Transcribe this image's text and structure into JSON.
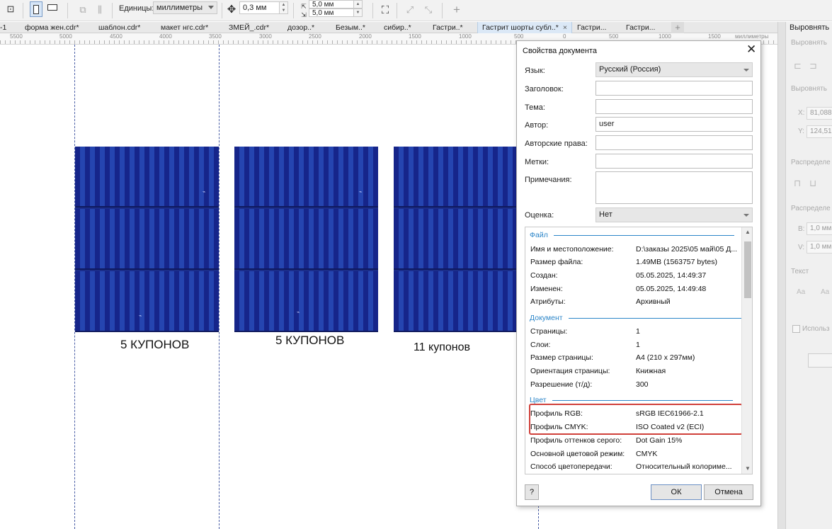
{
  "toolbar": {
    "units_label": "Единицы:",
    "units_value": "миллиметры",
    "nudge_value": "0,3 мм",
    "dup_x": "5,0 мм",
    "dup_y": "5,0 мм"
  },
  "tabs": [
    {
      "label": "-1"
    },
    {
      "label": "форма жен.cdr*"
    },
    {
      "label": "шаблон.cdr*"
    },
    {
      "label": "макет нгс.cdr*"
    },
    {
      "label": "ЗМЕЙ_.cdr*"
    },
    {
      "label": "дозор..*"
    },
    {
      "label": "Безым..*"
    },
    {
      "label": "сибир..*"
    },
    {
      "label": "Гастри..*"
    },
    {
      "label": "Гастрит шорты субл..*"
    },
    {
      "label": "Гастри..."
    },
    {
      "label": "Гастри..."
    }
  ],
  "ruler": {
    "ticks": [
      "5500",
      "5000",
      "4500",
      "4000",
      "3500",
      "3000",
      "2500",
      "2000",
      "1500",
      "1000",
      "500",
      "0",
      "500",
      "1000",
      "1500"
    ],
    "unit": "миллиметры"
  },
  "canvas": {
    "captions": [
      "5 КУПОНОВ",
      "5 КУПОНОВ",
      "11 купонов"
    ]
  },
  "panel": {
    "title": "Выровнять",
    "sub1": "Выровнять",
    "sub2": "Выровнять",
    "x_label": "X:",
    "x_value": "81,088",
    "y_label": "Y:",
    "y_value": "124,51",
    "distribute1": "Распределе",
    "distribute2": "Распределе",
    "b_label": "В:",
    "b_value": "1,0 мм",
    "v_label": "V:",
    "v_value": "1,0 мм",
    "text_label": "Текст",
    "use_label": "Использ"
  },
  "dialog": {
    "title": "Свойства документа",
    "fields": {
      "language_label": "Язык:",
      "language_value": "Русский (Россия)",
      "title_label": "Заголовок:",
      "subject_label": "Тема:",
      "author_label": "Автор:",
      "author_value": "user",
      "copyright_label": "Авторские права:",
      "keywords_label": "Метки:",
      "notes_label": "Примечания:",
      "rating_label": "Оценка:",
      "rating_value": "Нет"
    },
    "sections": {
      "file": "Файл",
      "document": "Документ",
      "color": "Цвет"
    },
    "file_info": [
      {
        "k": "Имя и местоположение:",
        "v": "D:\\заказы 2025\\05 май\\05 Д..."
      },
      {
        "k": "Размер файла:",
        "v": "1.49MB (1563757 bytes)"
      },
      {
        "k": "Создан:",
        "v": "05.05.2025, 14:49:37"
      },
      {
        "k": "Изменен:",
        "v": "05.05.2025, 14:49:48"
      },
      {
        "k": "Атрибуты:",
        "v": "Архивный"
      }
    ],
    "doc_info": [
      {
        "k": "Страницы:",
        "v": "1"
      },
      {
        "k": "Слои:",
        "v": "1"
      },
      {
        "k": "Размер страницы:",
        "v": "A4 (210 x 297мм)"
      },
      {
        "k": "Ориентация страницы:",
        "v": "Книжная"
      },
      {
        "k": "Разрешение (т/д):",
        "v": "300"
      }
    ],
    "color_info": [
      {
        "k": "Профиль RGB:",
        "v": "sRGB IEC61966-2.1"
      },
      {
        "k": "Профиль CMYK:",
        "v": "ISO Coated v2 (ECI)"
      },
      {
        "k": "Профиль оттенков серого:",
        "v": "Dot Gain 15%"
      },
      {
        "k": "Основной цветовой режим:",
        "v": "CMYK"
      },
      {
        "k": "Способ цветопередачи:",
        "v": "Относительный колориме..."
      }
    ],
    "help_label": "?",
    "ok_label": "ОК",
    "cancel_label": "Отмена"
  }
}
